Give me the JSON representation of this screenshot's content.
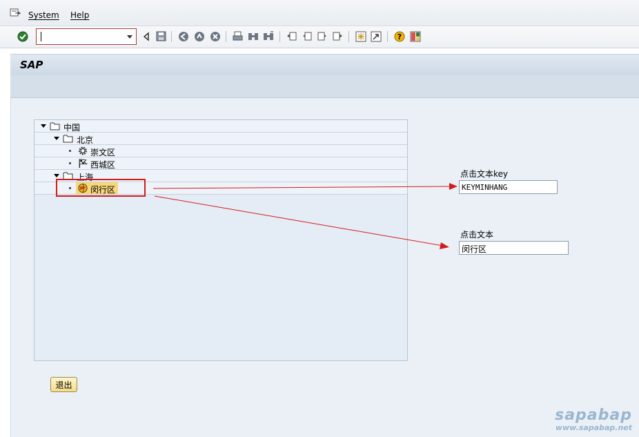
{
  "menu": {
    "items": [
      {
        "label": "System"
      },
      {
        "label": "Help"
      }
    ]
  },
  "toolbar": {
    "command_field_value": "",
    "icons": [
      "enter-icon",
      "back-arrow-icon",
      "save-icon",
      "back-icon",
      "exit-icon",
      "cancel-icon",
      "print-icon",
      "find-icon",
      "find-next-icon",
      "first-page-icon",
      "previous-page-icon",
      "next-page-icon",
      "last-page-icon",
      "create-session-icon",
      "shortcut-icon",
      "help-icon",
      "layout-icon"
    ]
  },
  "title": "SAP",
  "tree": {
    "nodes": [
      {
        "label": "中国",
        "icon": "folder-icon",
        "level": 0,
        "expanded": true
      },
      {
        "label": "北京",
        "icon": "folder-icon",
        "level": 1,
        "expanded": true
      },
      {
        "label": "崇文区",
        "icon": "gear-icon",
        "level": 2
      },
      {
        "label": "西城区",
        "icon": "flag-icon",
        "level": 2
      },
      {
        "label": "上海",
        "icon": "folder-icon",
        "level": 1,
        "expanded": true
      },
      {
        "label": "闵行区",
        "icon": "globe-icon",
        "level": 2,
        "selected": true
      }
    ]
  },
  "fields": {
    "key_label": "点击文本key",
    "key_value": "KEYMINHANG",
    "text_label": "点击文本",
    "text_value": "闵行区"
  },
  "exit_button": "退出",
  "watermark": {
    "big": "sapabap",
    "small": "www.sapabap.net"
  },
  "colors": {
    "annotation": "#d21b1b",
    "selection": "#f7d77c",
    "tree_bg": "#e4ecf5"
  }
}
